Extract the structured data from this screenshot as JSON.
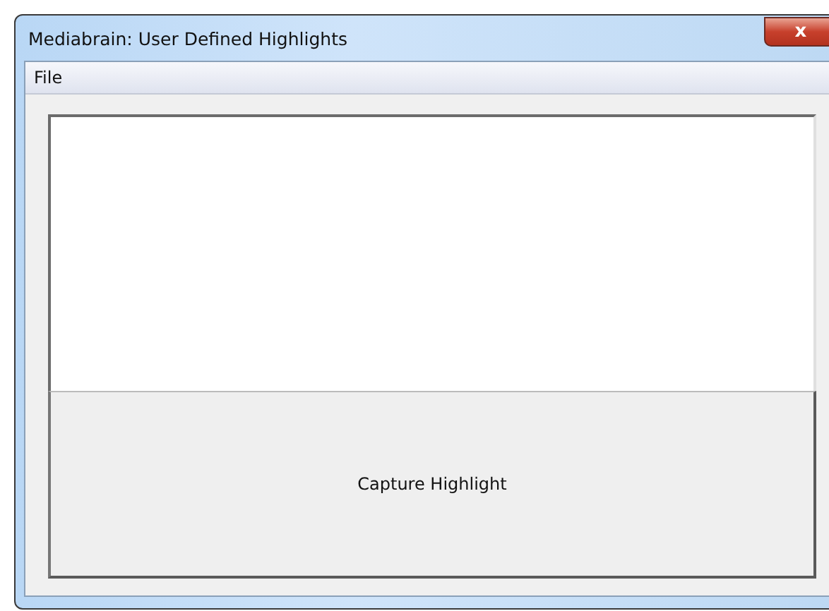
{
  "window": {
    "title": "Mediabrain: User Defined Highlights",
    "close_button": "x"
  },
  "menu_bar": [
    "File"
  ],
  "button": {
    "label": "Capture Highlight"
  }
}
